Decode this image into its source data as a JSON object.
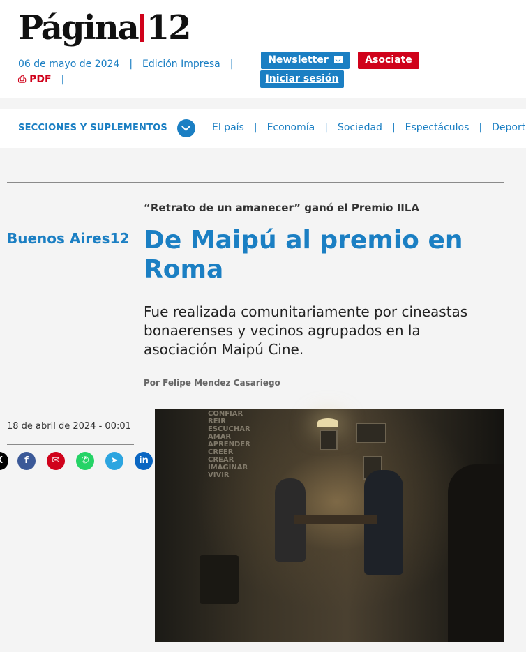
{
  "site": {
    "logo_text": "Página",
    "logo_number": "12",
    "date": "06 de mayo de 2024",
    "edition": "Edición Impresa",
    "pdf": "PDF"
  },
  "buttons": {
    "newsletter": "Newsletter",
    "asociate": "Asociate",
    "login": "Iniciar sesión"
  },
  "nav": {
    "title": "SECCIONES Y SUPLEMENTOS",
    "links": [
      "El país",
      "Economía",
      "Sociedad",
      "Espectáculos",
      "Deportes"
    ]
  },
  "article": {
    "section": "Buenos Aires12",
    "kicker": "“Retrato de un amanecer” ganó el Premio IILA",
    "title": "De Maipú al premio en Roma",
    "summary": "Fue realizada comunitariamente por cineastas bonaerenses y vecinos agrupados en la asociación Maipú Cine.",
    "byline": "Por Felipe Mendez Casariego",
    "date": "18 de abril de 2024 - 00:01",
    "photo_wall_text": [
      "CONFIAR",
      "REIR",
      "ESCUCHAR",
      "AMAR",
      "APRENDER",
      "CREER",
      "CREAR",
      "IMAGINAR",
      "VIVIR"
    ]
  },
  "share": {
    "x": "X",
    "facebook": "f",
    "email": "✉",
    "whatsapp": "✆",
    "telegram": "➤",
    "linkedin": "in"
  },
  "colors": {
    "brand_blue": "#1b7fc3",
    "brand_red": "#d0021b"
  }
}
